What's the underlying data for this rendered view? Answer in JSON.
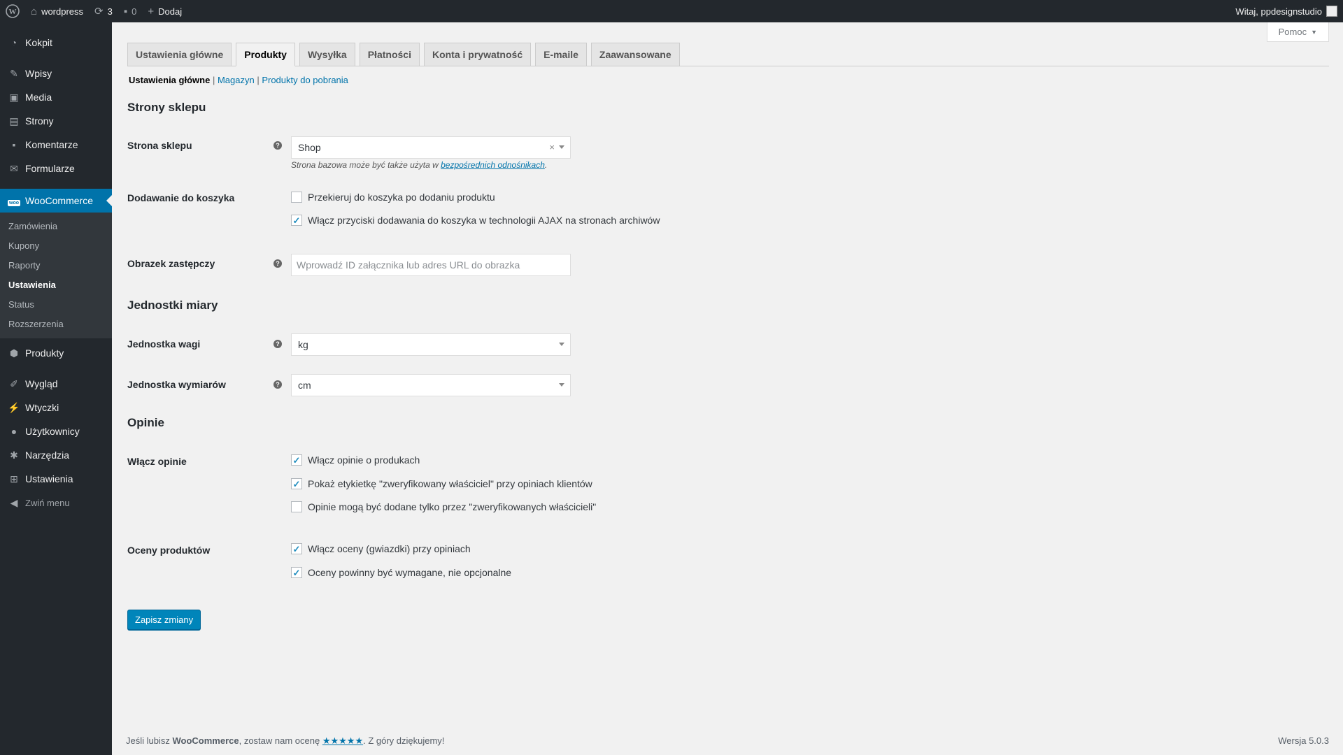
{
  "adminbar": {
    "site_name": "wordpress",
    "updates_count": "3",
    "comments_count": "0",
    "add_label": "Dodaj",
    "greeting": "Witaj, ppdesignstudio"
  },
  "sidebar": {
    "items_top": [
      {
        "label": "Kokpit",
        "icon": "dashboard-icon"
      },
      {
        "label": "Wpisy",
        "icon": "pin-icon"
      },
      {
        "label": "Media",
        "icon": "media-icon"
      },
      {
        "label": "Strony",
        "icon": "page-icon"
      },
      {
        "label": "Komentarze",
        "icon": "comment-icon"
      },
      {
        "label": "Formularze",
        "icon": "mail-icon"
      }
    ],
    "woocommerce": {
      "label": "WooCommerce",
      "icon": "woo-icon"
    },
    "woo_submenu": [
      "Zamówienia",
      "Kupony",
      "Raporty",
      "Ustawienia",
      "Status",
      "Rozszerzenia"
    ],
    "items_bottom": [
      {
        "label": "Produkty",
        "icon": "box-icon"
      },
      {
        "label": "Wygląd",
        "icon": "brush-icon"
      },
      {
        "label": "Wtyczki",
        "icon": "plugin-icon"
      },
      {
        "label": "Użytkownicy",
        "icon": "user-icon"
      },
      {
        "label": "Narzędzia",
        "icon": "wrench-icon"
      },
      {
        "label": "Ustawienia",
        "icon": "settings-icon"
      },
      {
        "label": "Zwiń menu",
        "icon": "collapse-icon"
      }
    ]
  },
  "help": {
    "label": "Pomoc"
  },
  "tabs": [
    "Ustawienia główne",
    "Produkty",
    "Wysyłka",
    "Płatności",
    "Konta i prywatność",
    "E-maile",
    "Zaawansowane"
  ],
  "active_tab": "Produkty",
  "subsub": {
    "current": "Ustawienia główne",
    "link1": "Magazyn",
    "link2": "Produkty do pobrania"
  },
  "sections": {
    "shop_pages": "Strony sklepu",
    "units": "Jednostki miary",
    "reviews": "Opinie"
  },
  "fields": {
    "shop_page": {
      "label": "Strona sklepu",
      "value": "Shop",
      "desc_prefix": "Strona bazowa może być także użyta w ",
      "desc_link": "bezpośrednich odnośnikach",
      "desc_suffix": "."
    },
    "add_to_cart": {
      "label": "Dodawanie do koszyka",
      "option1": "Przekieruj do koszyka po dodaniu produktu",
      "option1_checked": false,
      "option2": "Włącz przyciski dodawania do koszyka w technologii AJAX na stronach archiwów",
      "option2_checked": true
    },
    "placeholder_image": {
      "label": "Obrazek zastępczy",
      "placeholder": "Wprowadź ID załącznika lub adres URL do obrazka"
    },
    "weight_unit": {
      "label": "Jednostka wagi",
      "value": "kg"
    },
    "dimension_unit": {
      "label": "Jednostka wymiarów",
      "value": "cm"
    },
    "enable_reviews": {
      "label": "Włącz opinie",
      "option1": "Włącz opinie o produkach",
      "option1_checked": true,
      "option2": "Pokaż etykietkę \"zweryfikowany właściciel\" przy opiniach klientów",
      "option2_checked": true,
      "option3": "Opinie mogą być dodane tylko przez \"zweryfikowanych właścicieli\"",
      "option3_checked": false
    },
    "product_ratings": {
      "label": "Oceny produktów",
      "option1": "Włącz oceny (gwiazdki) przy opiniach",
      "option1_checked": true,
      "option2": "Oceny powinny być wymagane, nie opcjonalne",
      "option2_checked": true
    }
  },
  "save_button": "Zapisz zmiany",
  "footer": {
    "prefix": "Jeśli lubisz ",
    "brand": "WooCommerce",
    "middle": ", zostaw nam ocenę ",
    "stars": "★★★★★",
    "suffix": ". Z góry dziękujemy!",
    "version": "Wersja 5.0.3"
  },
  "colors": {
    "accent": "#0073aa",
    "button": "#0085ba",
    "sidebar_bg": "#23282d"
  }
}
